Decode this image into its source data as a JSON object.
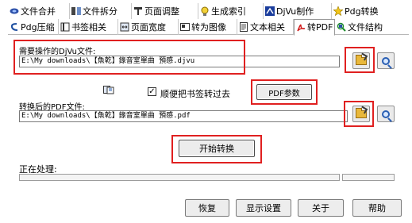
{
  "tabs_row1": [
    {
      "label": "文件合并",
      "icon": "merge-icon"
    },
    {
      "label": "文件拆分",
      "icon": "split-icon"
    },
    {
      "label": "页面调整",
      "icon": "page-adjust-icon"
    },
    {
      "label": "生成索引",
      "icon": "lightbulb-icon"
    },
    {
      "label": "DjVu制作",
      "icon": "djvu-make-icon"
    },
    {
      "label": "Pdg转换",
      "icon": "star-icon"
    }
  ],
  "tabs_row2": [
    {
      "label": "Pdg压缩",
      "icon": "compress-icon"
    },
    {
      "label": "书签相关",
      "icon": "bookmark-icon"
    },
    {
      "label": "页面宽度",
      "icon": "page-width-icon"
    },
    {
      "label": "转为图像",
      "icon": "image-convert-icon"
    },
    {
      "label": "文本相关",
      "icon": "text-icon"
    },
    {
      "label": "转PDF",
      "icon": "pdf-icon"
    },
    {
      "label": "文件结构",
      "icon": "structure-icon"
    }
  ],
  "active_tab": "转PDF",
  "source": {
    "label": "需要操作的DjVu文件:",
    "value": "E:\\My downloads\\【魚乾】錄音室單曲 預感.djvu"
  },
  "bookmark_checkbox": {
    "label": "顺便把书签转过去",
    "checked": true,
    "mark": "✓"
  },
  "pdf_params_label": "PDF参数",
  "output": {
    "label": "转换后的PDF文件:",
    "value": "E:\\My downloads\\【魚乾】錄音室單曲 預感.pdf"
  },
  "start_label": "开始转换",
  "progress_label": "正在处理:",
  "bottom_buttons": [
    "恢复",
    "显示设置",
    "关于",
    "帮助"
  ],
  "colors": {
    "highlight": "#e02020",
    "folder": "#e9b83b",
    "magnifier": "#2a5fb3"
  }
}
